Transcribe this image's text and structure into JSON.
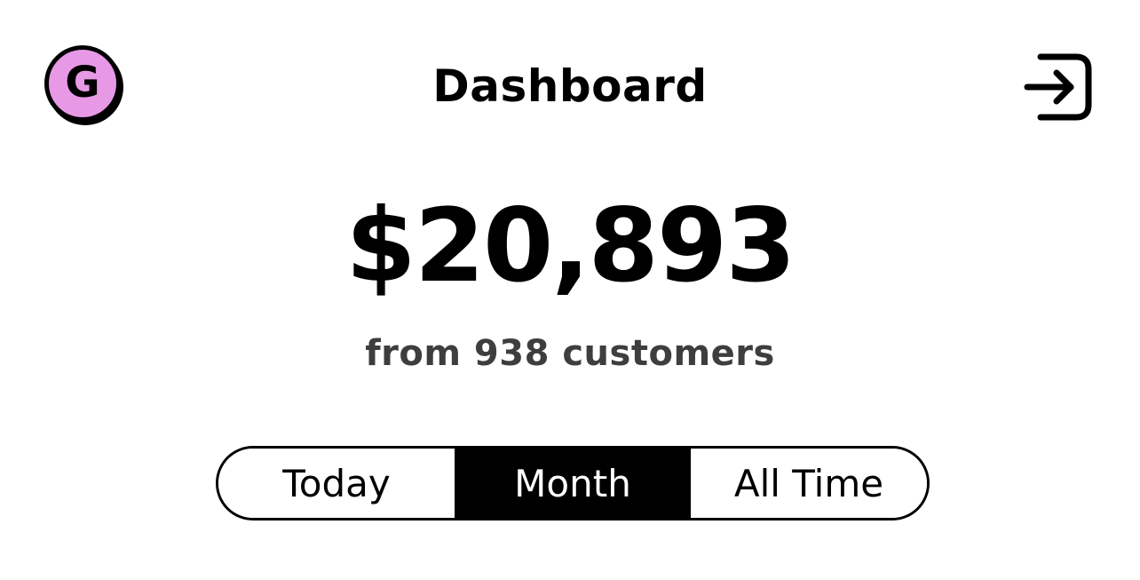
{
  "header": {
    "avatar_letter": "G",
    "avatar_color": "#e899e6",
    "title": "Dashboard",
    "login_icon": "login-arrow-icon"
  },
  "summary": {
    "amount": "$20,893",
    "subtitle": "from 938 customers"
  },
  "range_selector": {
    "options": [
      "Today",
      "Month",
      "All Time"
    ],
    "selected": "Month"
  }
}
